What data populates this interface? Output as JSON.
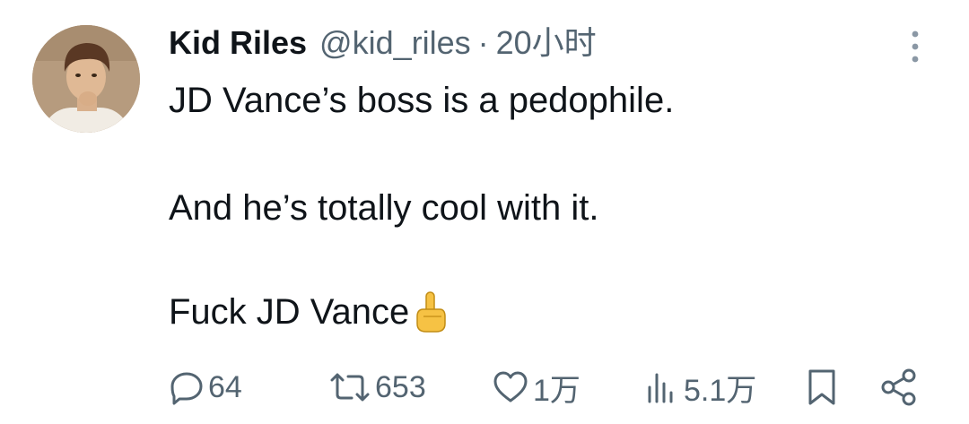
{
  "author": {
    "display_name": "Kid Riles",
    "handle": "@kid_riles",
    "separator": "·",
    "time": "20小时"
  },
  "tweet": {
    "line1": "JD Vance’s boss is a pedophile.",
    "line2": "And he’s totally cool with it.",
    "line3": "Fuck JD Vance",
    "emoji": "middle-finger-emoji"
  },
  "actions": {
    "replies": "64",
    "reposts": "653",
    "likes": "1万",
    "views": "5.1万"
  },
  "icons": {
    "reply": "reply-icon",
    "repost": "repost-icon",
    "like": "heart-icon",
    "views": "views-icon",
    "bookmark": "bookmark-icon",
    "share": "share-icon",
    "more": "more-icon"
  },
  "colors": {
    "text": "#0f1419",
    "secondary": "#536471",
    "background": "#ffffff"
  }
}
